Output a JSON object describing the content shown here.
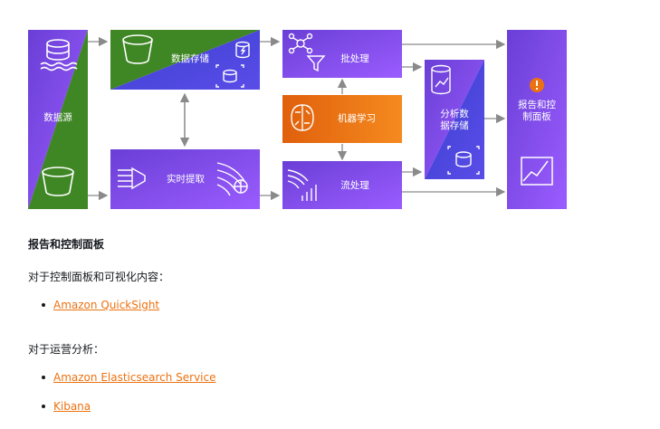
{
  "diagram": {
    "data_source": "数据源",
    "data_storage": "数据存储",
    "batch_processing": "批处理",
    "machine_learning": "机器学习",
    "realtime_ingest": "实时提取",
    "stream_processing": "流处理",
    "analytics_store_line1": "分析数",
    "analytics_store_line2": "据存储",
    "reporting_line1": "报告和控",
    "reporting_line2": "制面板",
    "colors": {
      "purple": "#8c4fff",
      "green": "#3f8624",
      "blue": "#4d4fe0",
      "orange": "#ec7211"
    }
  },
  "content": {
    "section_title": "报告和控制面板",
    "dashboards_intro": "对于控制面板和可视化内容：",
    "dashboards_links": [
      "Amazon QuickSight"
    ],
    "ops_intro": "对于运营分析：",
    "ops_links": [
      "Amazon Elasticsearch Service",
      "Kibana"
    ]
  }
}
